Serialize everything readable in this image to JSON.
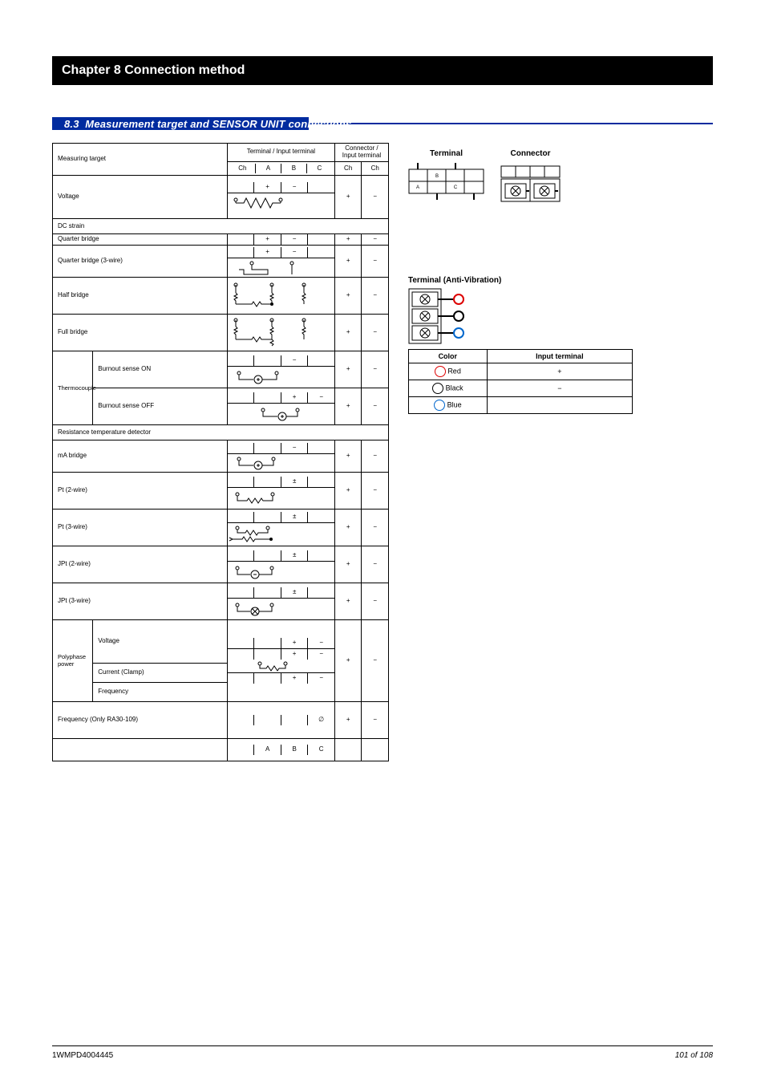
{
  "chapter_bar": "Chapter 8 Connection method",
  "section_number": "8.3",
  "section_title": "Measurement target and SENSOR UNIT connections",
  "main_table": {
    "col_target": "Measuring target",
    "col_terminal": "Terminal / Input terminal",
    "col_connector": "Connector / Input terminal",
    "th_ch": "Ch",
    "th_a": "A",
    "th_b": "B",
    "th_c": "C",
    "row_voltage": {
      "label": "Voltage",
      "a": "+",
      "b": "−",
      "c": "",
      "plus": "+",
      "minus": "−"
    },
    "group_dcstrain": "DC strain",
    "row_strain_quarter": {
      "label": "Quarter bridge",
      "a": "+",
      "b": "−",
      "c": "",
      "plus": "+",
      "minus": "−"
    },
    "row_strain_quarter3": {
      "label": "Quarter bridge (3-wire)",
      "a": "+",
      "b": "−",
      "c": "",
      "plus": "+",
      "minus": "−"
    },
    "row_strain_half": {
      "label": "Half bridge",
      "plus": "+",
      "minus": "−"
    },
    "row_strain_full": {
      "label": "Full bridge",
      "plus": "+",
      "minus": "−"
    },
    "group_tc": "Thermocouple",
    "row_tc_bursen": {
      "prefix": "Burnout sense",
      "label": "ON",
      "a": "",
      "b": "−",
      "c": "",
      "plus": "+",
      "minus": "−"
    },
    "row_tc_buroff": {
      "label": "OFF",
      "a": "",
      "b": "+",
      "c": "−",
      "plus": "+",
      "minus": "−"
    },
    "group_rtd": "Resistance temperature detector",
    "row_rtd_ma": {
      "label": "mA bridge",
      "a": "",
      "b": "−",
      "c": "",
      "plus": "+",
      "minus": "−"
    },
    "row_pt_2w": {
      "label": "Pt (2-wire)",
      "a": "",
      "b": "±",
      "c": "",
      "plus": "+",
      "minus": "−"
    },
    "row_pt_3w": {
      "label": "Pt (3-wire)",
      "a": "",
      "b": "±",
      "c": "",
      "plus": "+",
      "minus": "−"
    },
    "row_pt_jpt2": {
      "label": "JPt (2-wire)",
      "a": "",
      "b": "±",
      "c": "",
      "plus": "+",
      "minus": "−"
    },
    "row_pt_jpt3": {
      "label": "JPt (3-wire)",
      "a": "",
      "b": "±",
      "c": "",
      "plus": "+",
      "minus": "−"
    },
    "group_poly": "Polyphase power",
    "row_voltage2": {
      "label": "Voltage",
      "a": "",
      "b": "+",
      "c": "−"
    },
    "row_current": {
      "label": "Current (Clamp)",
      "a": "",
      "b": "+",
      "c": "−",
      "plus": "+",
      "minus": "−"
    },
    "row_freq2": {
      "label": "Frequency",
      "a": "",
      "b": "+",
      "c": "−"
    },
    "row_freq_only": {
      "label": "Frequency (Only RA30-109)",
      "c": "∅",
      "plus": "+",
      "minus": "−"
    },
    "row_bottom": {
      "a": "A",
      "b": "B",
      "c": "C",
      "plus": "",
      "minus": ""
    }
  },
  "right": {
    "terminal_heading": "Terminal",
    "connector_heading": "Connector",
    "vibration_heading": "Terminal (Anti-Vibration)",
    "lead_table": {
      "col_color": "Color",
      "col_input": "Input terminal",
      "red": "Red",
      "black": "Black",
      "blue": "Blue",
      "red_val": "+",
      "black_val": "−",
      "blue_val": ""
    }
  },
  "footer": {
    "doc_id": "1WMPD4004445",
    "page": "101 of 108"
  }
}
